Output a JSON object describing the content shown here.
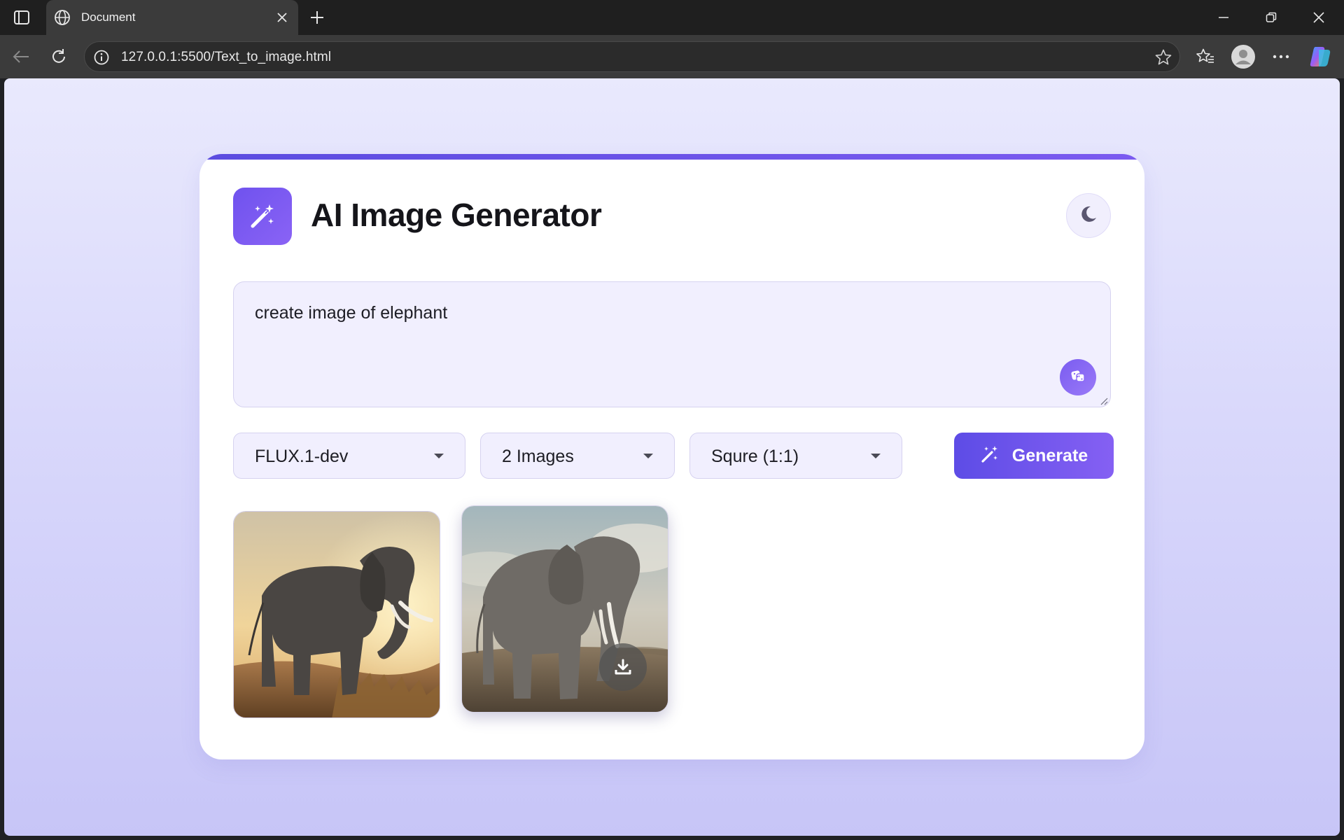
{
  "browser": {
    "tab_title": "Document",
    "url": "127.0.0.1:5500/Text_to_image.html"
  },
  "app": {
    "title": "AI Image Generator",
    "logo_icon": "magic-wand-icon",
    "theme_toggle_icon": "moon-icon"
  },
  "prompt": {
    "value": "create image of elephant",
    "random_button_icon": "dice-icon"
  },
  "controls": {
    "model": {
      "selected": "FLUX.1-dev"
    },
    "count": {
      "selected": "2 Images"
    },
    "ratio": {
      "selected": "Squre (1:1)"
    },
    "generate": {
      "label": "Generate",
      "icon": "magic-wand-icon"
    }
  },
  "results": {
    "images": [
      {
        "subject": "elephant"
      },
      {
        "subject": "elephant",
        "action_icon": "download-icon"
      }
    ]
  },
  "colors": {
    "accent": "#6a55ec",
    "accent_light": "#8a63f5",
    "page_bg_top": "#e9e9fd",
    "page_bg_bottom": "#c7c5f7",
    "input_bg": "#f1effe"
  }
}
